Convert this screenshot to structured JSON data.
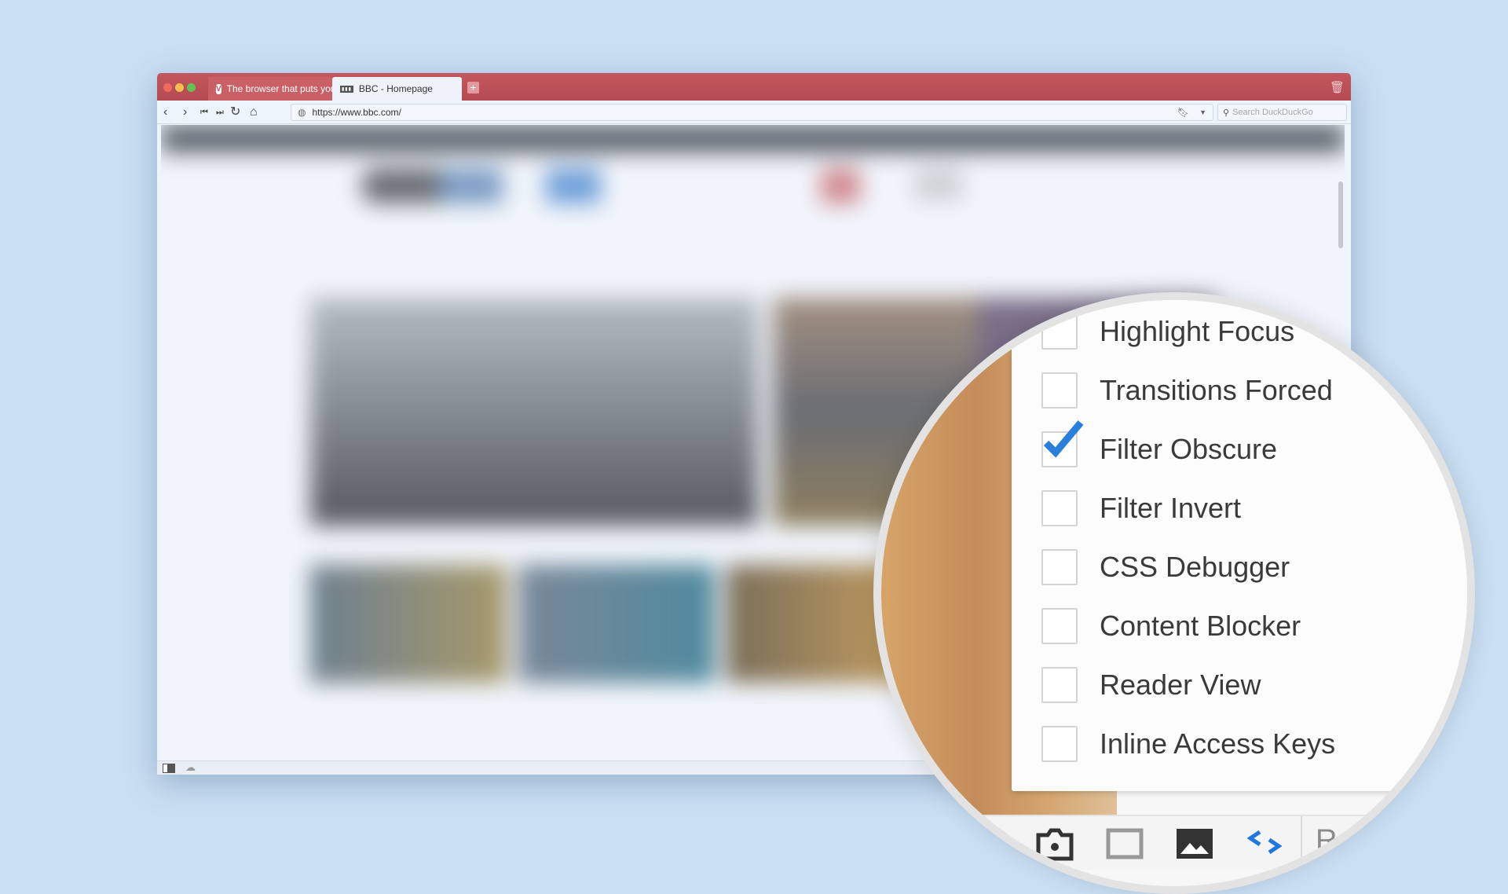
{
  "browser": {
    "tabs": [
      {
        "label": "The browser that puts you in control",
        "icon": "vivaldi-icon",
        "active": false
      },
      {
        "label": "BBC - Homepage",
        "icon": "bbc-favicon",
        "active": true
      }
    ],
    "url": "https://www.bbc.com/",
    "search_placeholder": "Search DuckDuckGo",
    "accent": "#c0525a"
  },
  "devmenu": {
    "items": [
      {
        "label": "Highlight Focus",
        "checked": false
      },
      {
        "label": "Transitions Forced",
        "checked": false
      },
      {
        "label": "Filter Obscure",
        "checked": true
      },
      {
        "label": "Filter Invert",
        "checked": false
      },
      {
        "label": "CSS Debugger",
        "checked": false
      },
      {
        "label": "Content Blocker",
        "checked": false
      },
      {
        "label": "Reader View",
        "checked": false
      },
      {
        "label": "Inline Access Keys",
        "checked": false
      }
    ],
    "check_color": "#2a7fdc"
  },
  "statusbar": {
    "reset_label": "Reset"
  }
}
